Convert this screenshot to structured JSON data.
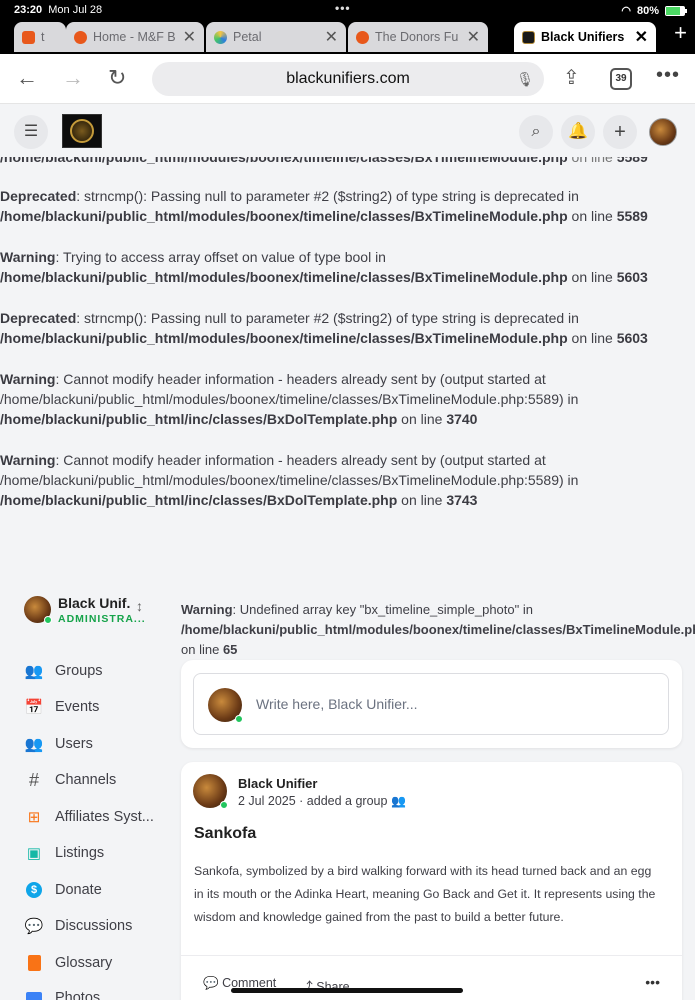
{
  "status": {
    "time": "23:20",
    "date": "Mon Jul 28",
    "battery": "80%",
    "battery_level": 0.8
  },
  "tabs": [
    {
      "label": "t",
      "color": "#e8581b"
    },
    {
      "label": "Home - M&F B",
      "color": "#e8581b"
    },
    {
      "label": "Petal",
      "color": "#2f7de1"
    },
    {
      "label": "The Donors Fu",
      "color": "#e8581b"
    },
    {
      "label": "Black Unifiers",
      "color": "#1a1a1a",
      "active": true
    }
  ],
  "address": {
    "url": "blackunifiers.com",
    "tab_count": "39"
  },
  "errors": [
    {
      "kind": "Deprecated",
      "msg": ": strncmp(): Passing null to parameter #2 ($string2) of type string is deprecated in",
      "path": "/home/blackuni/public_html/modules/boonex/timeline/classes/BxTimelineModule.php",
      "line": "5589"
    },
    {
      "kind": "Warning",
      "msg": ": Trying to access array offset on value of type bool in",
      "path": "/home/blackuni/public_html/modules/boonex/timeline/classes/BxTimelineModule.php",
      "line": "5603"
    },
    {
      "kind": "Deprecated",
      "msg": ": strncmp(): Passing null to parameter #2 ($string2) of type string is deprecated in",
      "path": "/home/blackuni/public_html/modules/boonex/timeline/classes/BxTimelineModule.php",
      "line": "5603"
    },
    {
      "kind": "Warning",
      "msg": ": Cannot modify header information - headers already sent by (output started at",
      "mid": "/home/blackuni/public_html/modules/boonex/timeline/classes/BxTimelineModule.php:5589) in",
      "path": "/home/blackuni/public_html/inc/classes/BxDolTemplate.php",
      "line": "3740"
    },
    {
      "kind": "Warning",
      "msg": ": Cannot modify header information - headers already sent by (output started at",
      "mid": "/home/blackuni/public_html/modules/boonex/timeline/classes/BxTimelineModule.php:5589) in",
      "path": "/home/blackuni/public_html/inc/classes/BxDolTemplate.php",
      "line": "3743"
    }
  ],
  "on_line": "on line",
  "profile": {
    "name": "Black Unif.",
    "role": "ADMINISTRA..."
  },
  "menu": [
    {
      "label": "Groups",
      "icon": "groups-icon",
      "glyph": "👥",
      "color": "#555"
    },
    {
      "label": "Events",
      "icon": "calendar-icon",
      "glyph": "📅",
      "color": "#555"
    },
    {
      "label": "Users",
      "icon": "users-icon",
      "glyph": "👥",
      "color": "#555"
    },
    {
      "label": "Channels",
      "icon": "hashtag-icon",
      "glyph": "#",
      "color": "#555"
    },
    {
      "label": "Affiliates Syst...",
      "icon": "sitemap-icon",
      "glyph": "⊞",
      "color": "#f97316"
    },
    {
      "label": "Listings",
      "icon": "briefcase-icon",
      "glyph": "▣",
      "color": "#14b8a6"
    },
    {
      "label": "Donate",
      "icon": "dollar-icon",
      "glyph": "$",
      "color": "#0ea5e9"
    },
    {
      "label": "Discussions",
      "icon": "comments-icon",
      "glyph": "💬",
      "color": "#8b5cf6"
    },
    {
      "label": "Glossary",
      "icon": "book-icon",
      "glyph": "▮",
      "color": "#f97316"
    },
    {
      "label": "Photos",
      "icon": "photo-icon",
      "glyph": "▦",
      "color": "#3b82f6"
    }
  ],
  "timeline_warning": {
    "kind": "Warning",
    "msg": ": Undefined array key \"bx_timeline_simple_photo\" in",
    "path": "/home/blackuni/public_html/modules/boonex/timeline/classes/BxTimelineModule.php",
    "on_line": "on line",
    "line": "65"
  },
  "composer": {
    "placeholder": "Write here, Black Unifier..."
  },
  "post": {
    "author": "Black Unifier",
    "meta": "2 Jul 2025 · added a group",
    "title": "Sankofa",
    "body": "Sankofa, symbolized by a bird walking forward with its head turned back and an egg in its mouth or the Adinka Heart, meaning Go Back and Get it. It represents using the wisdom and knowledge gained from the past to build a better future.",
    "comment_label": "Comment",
    "share_label": "Share"
  }
}
